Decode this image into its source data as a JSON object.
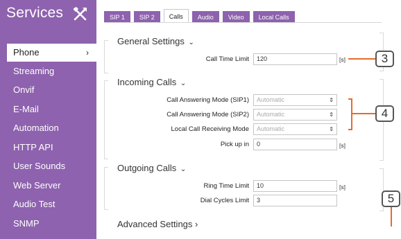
{
  "sidebar": {
    "title": "Services",
    "items": [
      {
        "label": "Phone",
        "active": true,
        "chevron": "›"
      },
      {
        "label": "Streaming"
      },
      {
        "label": "Onvif"
      },
      {
        "label": "E-Mail"
      },
      {
        "label": "Automation"
      },
      {
        "label": "HTTP API"
      },
      {
        "label": "User Sounds"
      },
      {
        "label": "Web Server"
      },
      {
        "label": "Audio Test"
      },
      {
        "label": "SNMP"
      }
    ]
  },
  "tabs": [
    {
      "label": "SIP 1"
    },
    {
      "label": "SIP 2"
    },
    {
      "label": "Calls",
      "active": true
    },
    {
      "label": "Audio"
    },
    {
      "label": "Video"
    },
    {
      "label": "Local Calls"
    }
  ],
  "sections": {
    "general": {
      "title": "General Settings",
      "chevron": "⌄",
      "call_time_limit": {
        "label": "Call Time Limit",
        "value": "120",
        "unit": "[s]"
      }
    },
    "incoming": {
      "title": "Incoming Calls",
      "chevron": "⌄",
      "sip1_mode": {
        "label": "Call Answering Mode (SIP1)",
        "value": "Automatic"
      },
      "sip2_mode": {
        "label": "Call Answering Mode (SIP2)",
        "value": "Automatic"
      },
      "local_mode": {
        "label": "Local Call Receiving Mode",
        "value": "Automatic"
      },
      "pick_up_in": {
        "label": "Pick up in",
        "value": "0",
        "unit": "[s]"
      }
    },
    "outgoing": {
      "title": "Outgoing Calls",
      "chevron": "⌄",
      "ring_time_limit": {
        "label": "Ring Time Limit",
        "value": "10",
        "unit": "[s]"
      },
      "dial_cycles_limit": {
        "label": "Dial Cycles Limit",
        "value": "3"
      }
    },
    "advanced": {
      "title": "Advanced Settings",
      "chevron": "›"
    }
  },
  "callouts": {
    "c3": "3",
    "c4": "4",
    "c5": "5"
  },
  "colors": {
    "sidebar": "#8e62ae",
    "callout_line": "#e86a2a"
  },
  "icons": {
    "tools": "tools-icon",
    "select_arrows": "⇕"
  }
}
